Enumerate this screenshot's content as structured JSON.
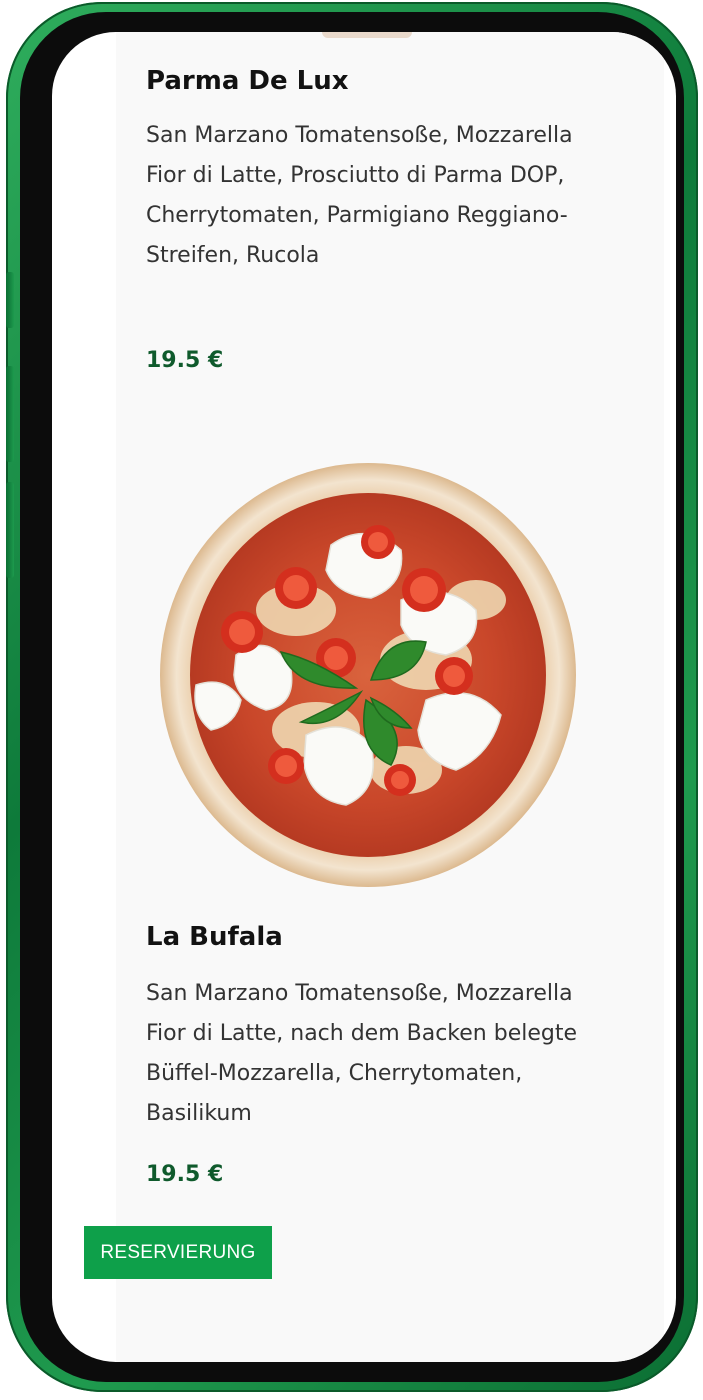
{
  "menu": {
    "items": [
      {
        "title": "Parma De Lux",
        "description": "San Marzano Tomatensoße, Mozzarella Fior di Latte, Prosciutto di Parma DOP, Cherrytomaten, Parmigiano Reggiano-Streifen, Rucola",
        "price": "19.5 €"
      },
      {
        "title": "La Bufala",
        "description": "San Marzano Tomatensoße, Mozzarella Fior di Latte, nach dem Backen belegte Büffel-Mozzarella, Cherrytomaten, Basilikum",
        "price": "19.5 €"
      }
    ]
  },
  "actions": {
    "reserve_label": "RESERVIERUNG"
  },
  "colors": {
    "accent_green": "#0ea04a",
    "price_green": "#0f5a2c",
    "frame_green": "#1f9a4e"
  },
  "icons": {
    "pizza_image": "pizza-la-bufala-illustration"
  }
}
